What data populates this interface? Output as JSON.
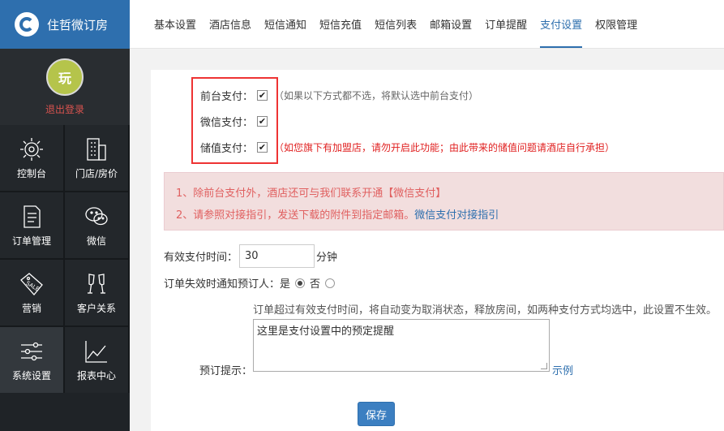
{
  "brand": {
    "name": "住哲微订房"
  },
  "profile": {
    "logout": "退出登录",
    "avatar_text": "玩"
  },
  "sidebar": {
    "tiles": [
      {
        "label": "控制台",
        "icon": "dashboard-icon"
      },
      {
        "label": "门店/房价",
        "icon": "building-icon"
      },
      {
        "label": "订单管理",
        "icon": "document-icon"
      },
      {
        "label": "微信",
        "icon": "wechat-icon"
      },
      {
        "label": "营销",
        "icon": "sale-tag-icon"
      },
      {
        "label": "客户关系",
        "icon": "glasses-cheers-icon"
      },
      {
        "label": "系统设置",
        "icon": "sliders-icon",
        "active": true
      },
      {
        "label": "报表中心",
        "icon": "line-chart-icon"
      }
    ]
  },
  "tabs": [
    "基本设置",
    "酒店信息",
    "短信通知",
    "短信充值",
    "短信列表",
    "邮箱设置",
    "订单提醒",
    "支付设置",
    "权限管理"
  ],
  "active_tab": "支付设置",
  "payment": {
    "front_desk": {
      "label": "前台支付：",
      "checked": true,
      "hint": "（如果以下方式都不选，将默认选中前台支付）"
    },
    "wechat": {
      "label": "微信支付：",
      "checked": true
    },
    "stored_value": {
      "label": "储值支付：",
      "checked": true,
      "hint": "（如您旗下有加盟店，请勿开启此功能；由此带来的储值问题请酒店自行承担）"
    }
  },
  "alert": {
    "line1": "1、除前台支付外，酒店还可与我们联系开通【微信支付】",
    "line2": "2、请参照对接指引，发送下载的附件到指定邮箱。",
    "line2_link": "微信支付对接指引"
  },
  "form": {
    "timeout_label": "有效支付时间：",
    "timeout_value": "30",
    "timeout_unit": "分钟",
    "notify_label": "订单失效时通知预订人：",
    "yes": "是",
    "no": "否",
    "notify_value": "yes",
    "note": "订单超过有效支付时间，将自动变为取消状态，释放房间，如两种支付方式均选中，此设置不生效。",
    "tip_label": "预订提示：",
    "tip_value": "这里是支付设置中的预定提醒",
    "example_link": "示例",
    "save": "保存"
  },
  "colors": {
    "brand_blue": "#2e6fae",
    "sidebar_dark": "#1f2327",
    "alert_bg": "#f2dede",
    "alert_text": "#e06060",
    "highlight_red": "#e33333"
  }
}
